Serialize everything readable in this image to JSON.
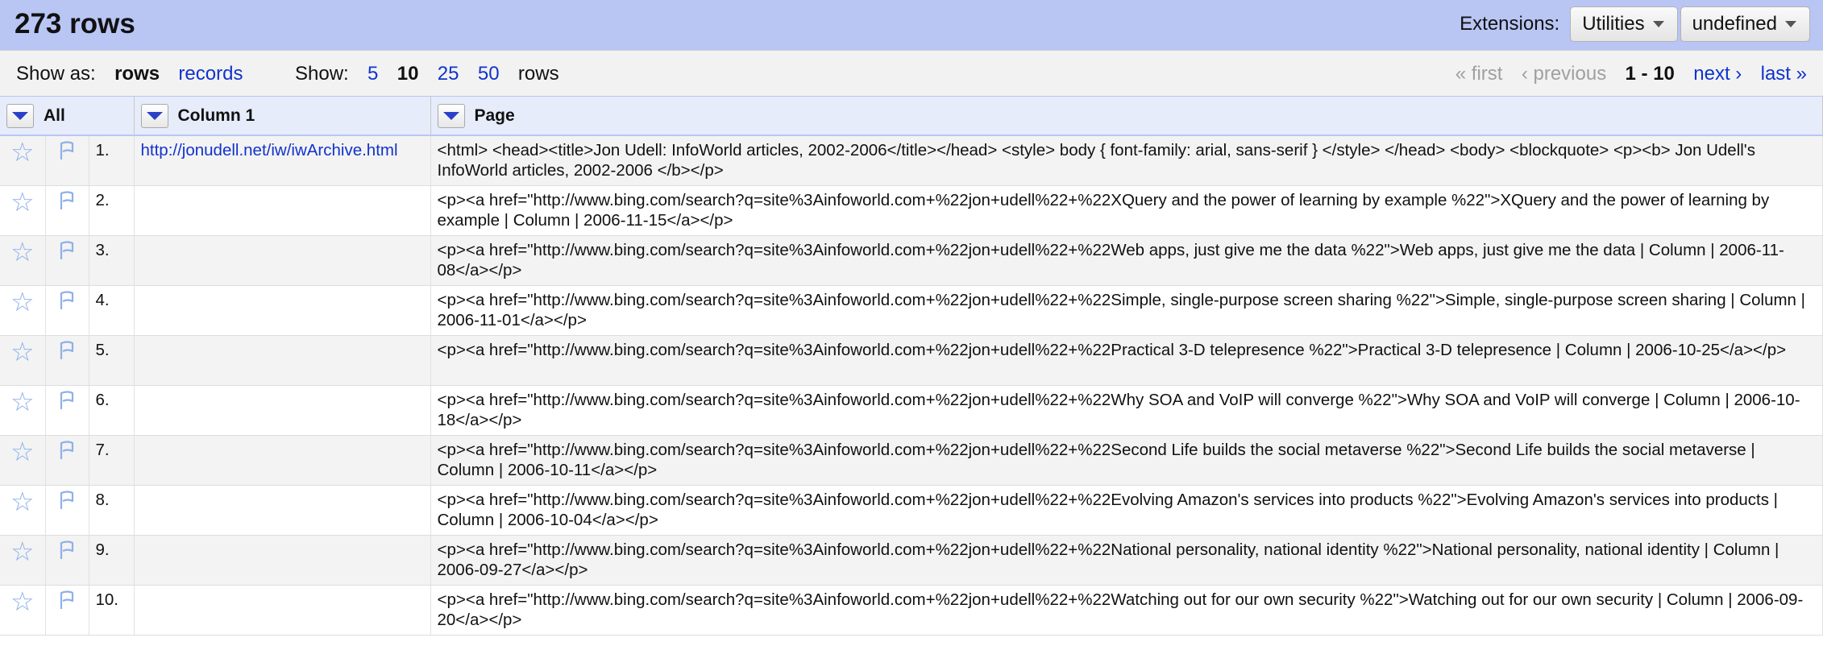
{
  "header": {
    "row_count": "273 rows",
    "extensions_label": "Extensions:",
    "utilities_label": "Utilities",
    "undefined_label": "undefined"
  },
  "viewbar": {
    "show_as_label": "Show as:",
    "rows_mode": "rows",
    "records_mode": "records",
    "show_label": "Show:",
    "sizes": [
      "5",
      "10",
      "25",
      "50"
    ],
    "rows_suffix": "rows",
    "first": "« first",
    "previous": "‹ previous",
    "range": "1 - 10",
    "next": "next ›",
    "last": "last »"
  },
  "columns": {
    "all": "All",
    "col1": "Column 1",
    "page": "Page"
  },
  "rows": [
    {
      "index": "1.",
      "col1": "http://jonudell.net/iw/iwArchive.html",
      "page": "<html> <head><title>Jon Udell: InfoWorld articles, 2002-2006</title></head> <style> body { font-family: arial, sans-serif } </style> </head> <body> <blockquote> <p><b> Jon Udell's InfoWorld articles, 2002-2006 </b></p>"
    },
    {
      "index": "2.",
      "col1": "",
      "page": "<p><a href=\"http://www.bing.com/search?q=site%3Ainfoworld.com+%22jon+udell%22+%22XQuery and the power of learning by example %22\">XQuery and the power of learning by example | Column | 2006-11-15</a></p>"
    },
    {
      "index": "3.",
      "col1": "",
      "page": "<p><a href=\"http://www.bing.com/search?q=site%3Ainfoworld.com+%22jon+udell%22+%22Web apps, just give me the data %22\">Web apps, just give me the data | Column | 2006-11-08</a></p>"
    },
    {
      "index": "4.",
      "col1": "",
      "page": "<p><a href=\"http://www.bing.com/search?q=site%3Ainfoworld.com+%22jon+udell%22+%22Simple, single-purpose screen sharing %22\">Simple, single-purpose screen sharing | Column | 2006-11-01</a></p>"
    },
    {
      "index": "5.",
      "col1": "",
      "page": "<p><a href=\"http://www.bing.com/search?q=site%3Ainfoworld.com+%22jon+udell%22+%22Practical 3-D telepresence %22\">Practical 3-D telepresence | Column | 2006-10-25</a></p>"
    },
    {
      "index": "6.",
      "col1": "",
      "page": "<p><a href=\"http://www.bing.com/search?q=site%3Ainfoworld.com+%22jon+udell%22+%22Why SOA and VoIP will converge %22\">Why SOA and VoIP will converge | Column | 2006-10-18</a></p>"
    },
    {
      "index": "7.",
      "col1": "",
      "page": "<p><a href=\"http://www.bing.com/search?q=site%3Ainfoworld.com+%22jon+udell%22+%22Second Life builds the social metaverse %22\">Second Life builds the social metaverse | Column | 2006-10-11</a></p>"
    },
    {
      "index": "8.",
      "col1": "",
      "page": "<p><a href=\"http://www.bing.com/search?q=site%3Ainfoworld.com+%22jon+udell%22+%22Evolving Amazon's services into products %22\">Evolving Amazon's services into products | Column | 2006-10-04</a></p>"
    },
    {
      "index": "9.",
      "col1": "",
      "page": "<p><a href=\"http://www.bing.com/search?q=site%3Ainfoworld.com+%22jon+udell%22+%22National personality, national identity %22\">National personality, national identity | Column | 2006-09-27</a></p>"
    },
    {
      "index": "10.",
      "col1": "",
      "page": "<p><a href=\"http://www.bing.com/search?q=site%3Ainfoworld.com+%22jon+udell%22+%22Watching out for our own security %22\">Watching out for our own security | Column | 2006-09-20</a></p>"
    }
  ],
  "icons": {
    "star": "star-icon",
    "flag": "flag-icon",
    "dropdown": "chevron-down-icon"
  },
  "colors": {
    "header_bg": "#b9c6f4",
    "link": "#1133cc",
    "star": "#8eb1e8",
    "dropdown_arrow": "#2a41c7"
  }
}
